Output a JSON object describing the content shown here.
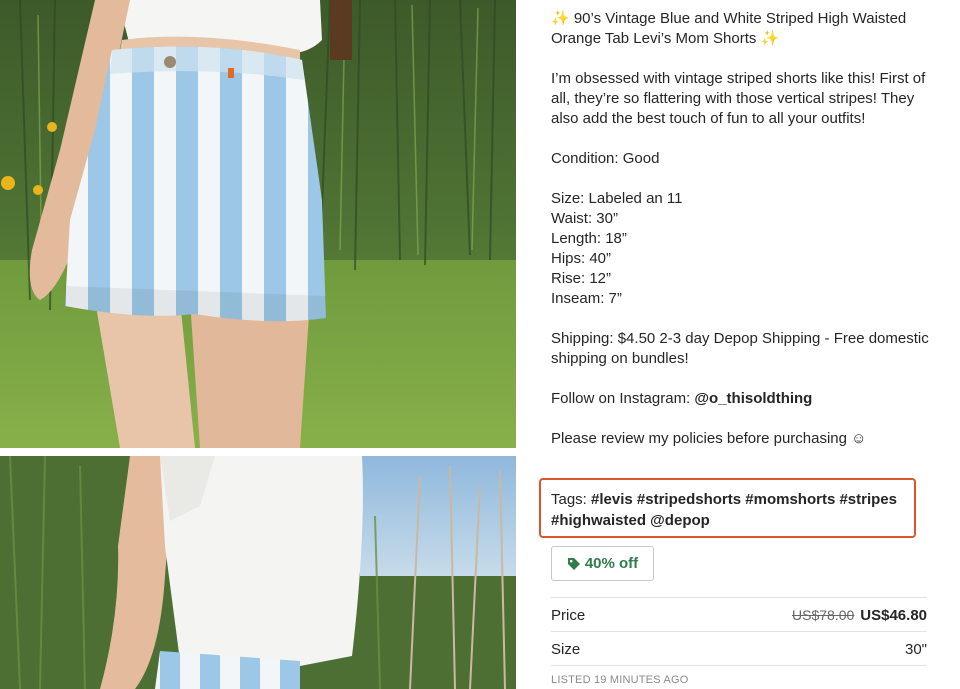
{
  "listing": {
    "title_line": "✨ 90’s Vintage Blue and White Striped High Waisted Orange Tab Levi’s Mom Shorts ✨",
    "intro": "I’m obsessed with vintage striped shorts like this! First of all, they’re so flattering with those vertical stripes! They also add the best touch of fun to all your outfits!",
    "condition": "Condition: Good",
    "measurements": "Size: Labeled an 11\nWaist: 30”\nLength: 18”\nHips: 40”\nRise: 12”\nInseam: 7”",
    "shipping": "Shipping: $4.50 2-3 day Depop Shipping - Free domestic shipping on bundles!",
    "follow_prefix": "Follow on Instagram: ",
    "follow_handle": "@o_thisoldthing",
    "policies": "Please review my policies before purchasing ☺"
  },
  "tags": {
    "prefix": "Tags: ",
    "values": "#levis #stripedshorts #momshorts #stripes #highwaisted @depop"
  },
  "discount": {
    "label": "40% off",
    "icon": "tag-icon"
  },
  "price": {
    "label": "Price",
    "original": "US$78.00",
    "current": "US$46.80"
  },
  "size": {
    "label": "Size",
    "value": "30\""
  },
  "listed": "LISTED 19 MINUTES AGO",
  "colors": {
    "highlight_border": "#d9572b",
    "discount_green": "#2f7d4b",
    "stripe_blue": "#9cc7e6"
  }
}
